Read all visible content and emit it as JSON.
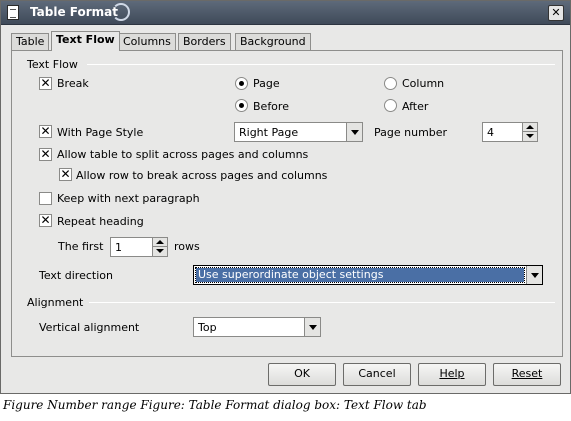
{
  "window": {
    "title": "Table Format",
    "close_glyph": "✕"
  },
  "tabs": [
    {
      "label": "Table",
      "active": false
    },
    {
      "label": "Text Flow",
      "active": true
    },
    {
      "label": "Columns",
      "active": false
    },
    {
      "label": "Borders",
      "active": false
    },
    {
      "label": "Background",
      "active": false
    }
  ],
  "text_flow": {
    "group_label": "Text Flow",
    "break": {
      "label": "Break",
      "checked": true
    },
    "page_radio": {
      "label": "Page",
      "checked": true
    },
    "column_radio": {
      "label": "Column",
      "checked": false
    },
    "before_radio": {
      "label": "Before",
      "checked": true
    },
    "after_radio": {
      "label": "After",
      "checked": false
    },
    "with_page_style": {
      "label": "With Page Style",
      "checked": true
    },
    "page_style_select": {
      "value": "Right Page"
    },
    "page_number": {
      "label": "Page number",
      "value": "4"
    },
    "allow_split": {
      "label": "Allow table to split across pages and columns",
      "checked": true
    },
    "allow_row_break": {
      "label": "Allow row to break across pages and columns",
      "checked": true
    },
    "keep_with_next": {
      "label": "Keep with next paragraph",
      "checked": false
    },
    "repeat_heading": {
      "label": "Repeat heading",
      "checked": true
    },
    "first_rows": {
      "prefix": "The first",
      "value": "1",
      "suffix": "rows"
    },
    "text_direction": {
      "label": "Text direction",
      "value": "Use superordinate object settings"
    }
  },
  "alignment": {
    "group_label": "Alignment",
    "vertical_alignment": {
      "label": "Vertical alignment",
      "value": "Top"
    }
  },
  "buttons": {
    "ok": "OK",
    "cancel": "Cancel",
    "help": "Help",
    "reset": "Reset"
  },
  "caption": "Figure Number range Figure: Table Format dialog box: Text Flow tab",
  "check_glyph": "✕"
}
